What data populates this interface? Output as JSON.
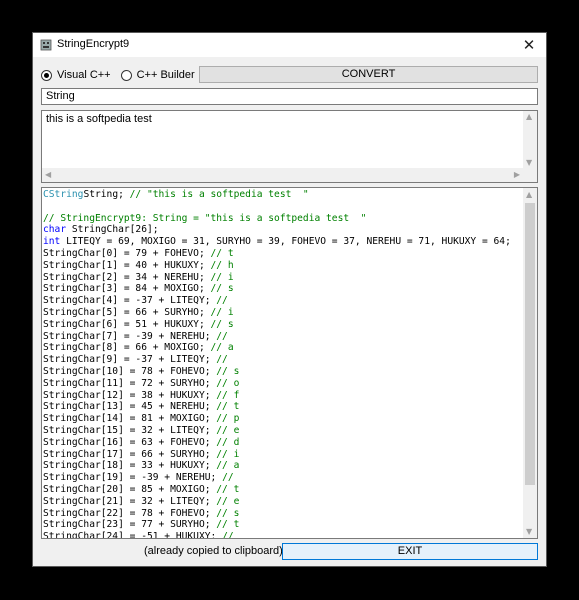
{
  "window": {
    "title": "StringEncrypt9",
    "close_glyph": "✕"
  },
  "options": {
    "radio1_label": "Visual C++",
    "radio1_checked": true,
    "radio2_label": "C++ Builder",
    "radio2_checked": false
  },
  "convert_label": "CONVERT",
  "variable_name": "String",
  "input_text": "this is a softpedia test",
  "code_lines": [
    [
      [
        "ty",
        "CString"
      ],
      [
        "",
        "String; "
      ],
      [
        "cm",
        "// \"this is a softpedia test  \""
      ]
    ],
    [],
    [
      [
        "cm",
        "// StringEncrypt9: String = \"this is a softpedia test  \""
      ]
    ],
    [
      [
        "kw",
        "char"
      ],
      [
        "",
        " StringChar[26];"
      ]
    ],
    [
      [
        "kw",
        "int"
      ],
      [
        "",
        " LITEQY = 69, MOXIGO = 31, SURYHO = 39, FOHEVO = 37, NEREHU = 71, HUKUXY = 64;"
      ]
    ],
    [
      [
        "",
        "StringChar[0] = 79 + FOHEVO; "
      ],
      [
        "cm",
        "// t"
      ]
    ],
    [
      [
        "",
        "StringChar[1] = 40 + HUKUXY; "
      ],
      [
        "cm",
        "// h"
      ]
    ],
    [
      [
        "",
        "StringChar[2] = 34 + NEREHU; "
      ],
      [
        "cm",
        "// i"
      ]
    ],
    [
      [
        "",
        "StringChar[3] = 84 + MOXIGO; "
      ],
      [
        "cm",
        "// s"
      ]
    ],
    [
      [
        "",
        "StringChar[4] = -37 + LITEQY; "
      ],
      [
        "cm",
        "//"
      ]
    ],
    [
      [
        "",
        "StringChar[5] = 66 + SURYHO; "
      ],
      [
        "cm",
        "// i"
      ]
    ],
    [
      [
        "",
        "StringChar[6] = 51 + HUKUXY; "
      ],
      [
        "cm",
        "// s"
      ]
    ],
    [
      [
        "",
        "StringChar[7] = -39 + NEREHU; "
      ],
      [
        "cm",
        "//"
      ]
    ],
    [
      [
        "",
        "StringChar[8] = 66 + MOXIGO; "
      ],
      [
        "cm",
        "// a"
      ]
    ],
    [
      [
        "",
        "StringChar[9] = -37 + LITEQY; "
      ],
      [
        "cm",
        "//"
      ]
    ],
    [
      [
        "",
        "StringChar[10] = 78 + FOHEVO; "
      ],
      [
        "cm",
        "// s"
      ]
    ],
    [
      [
        "",
        "StringChar[11] = 72 + SURYHO; "
      ],
      [
        "cm",
        "// o"
      ]
    ],
    [
      [
        "",
        "StringChar[12] = 38 + HUKUXY; "
      ],
      [
        "cm",
        "// f"
      ]
    ],
    [
      [
        "",
        "StringChar[13] = 45 + NEREHU; "
      ],
      [
        "cm",
        "// t"
      ]
    ],
    [
      [
        "",
        "StringChar[14] = 81 + MOXIGO; "
      ],
      [
        "cm",
        "// p"
      ]
    ],
    [
      [
        "",
        "StringChar[15] = 32 + LITEQY; "
      ],
      [
        "cm",
        "// e"
      ]
    ],
    [
      [
        "",
        "StringChar[16] = 63 + FOHEVO; "
      ],
      [
        "cm",
        "// d"
      ]
    ],
    [
      [
        "",
        "StringChar[17] = 66 + SURYHO; "
      ],
      [
        "cm",
        "// i"
      ]
    ],
    [
      [
        "",
        "StringChar[18] = 33 + HUKUXY; "
      ],
      [
        "cm",
        "// a"
      ]
    ],
    [
      [
        "",
        "StringChar[19] = -39 + NEREHU; "
      ],
      [
        "cm",
        "//"
      ]
    ],
    [
      [
        "",
        "StringChar[20] = 85 + MOXIGO; "
      ],
      [
        "cm",
        "// t"
      ]
    ],
    [
      [
        "",
        "StringChar[21] = 32 + LITEQY; "
      ],
      [
        "cm",
        "// e"
      ]
    ],
    [
      [
        "",
        "StringChar[22] = 78 + FOHEVO; "
      ],
      [
        "cm",
        "// s"
      ]
    ],
    [
      [
        "",
        "StringChar[23] = 77 + SURYHO; "
      ],
      [
        "cm",
        "// t"
      ]
    ],
    [
      [
        "",
        "StringChar[24] = -51 + HUKUXY; "
      ],
      [
        "cm",
        "//"
      ]
    ]
  ],
  "status_text": "(already copied to clipboard)",
  "exit_label": "EXIT",
  "colors": {
    "keyword": "#0000ff",
    "comment": "#008000",
    "type": "#2b91af",
    "exit_border": "#0078d7"
  }
}
